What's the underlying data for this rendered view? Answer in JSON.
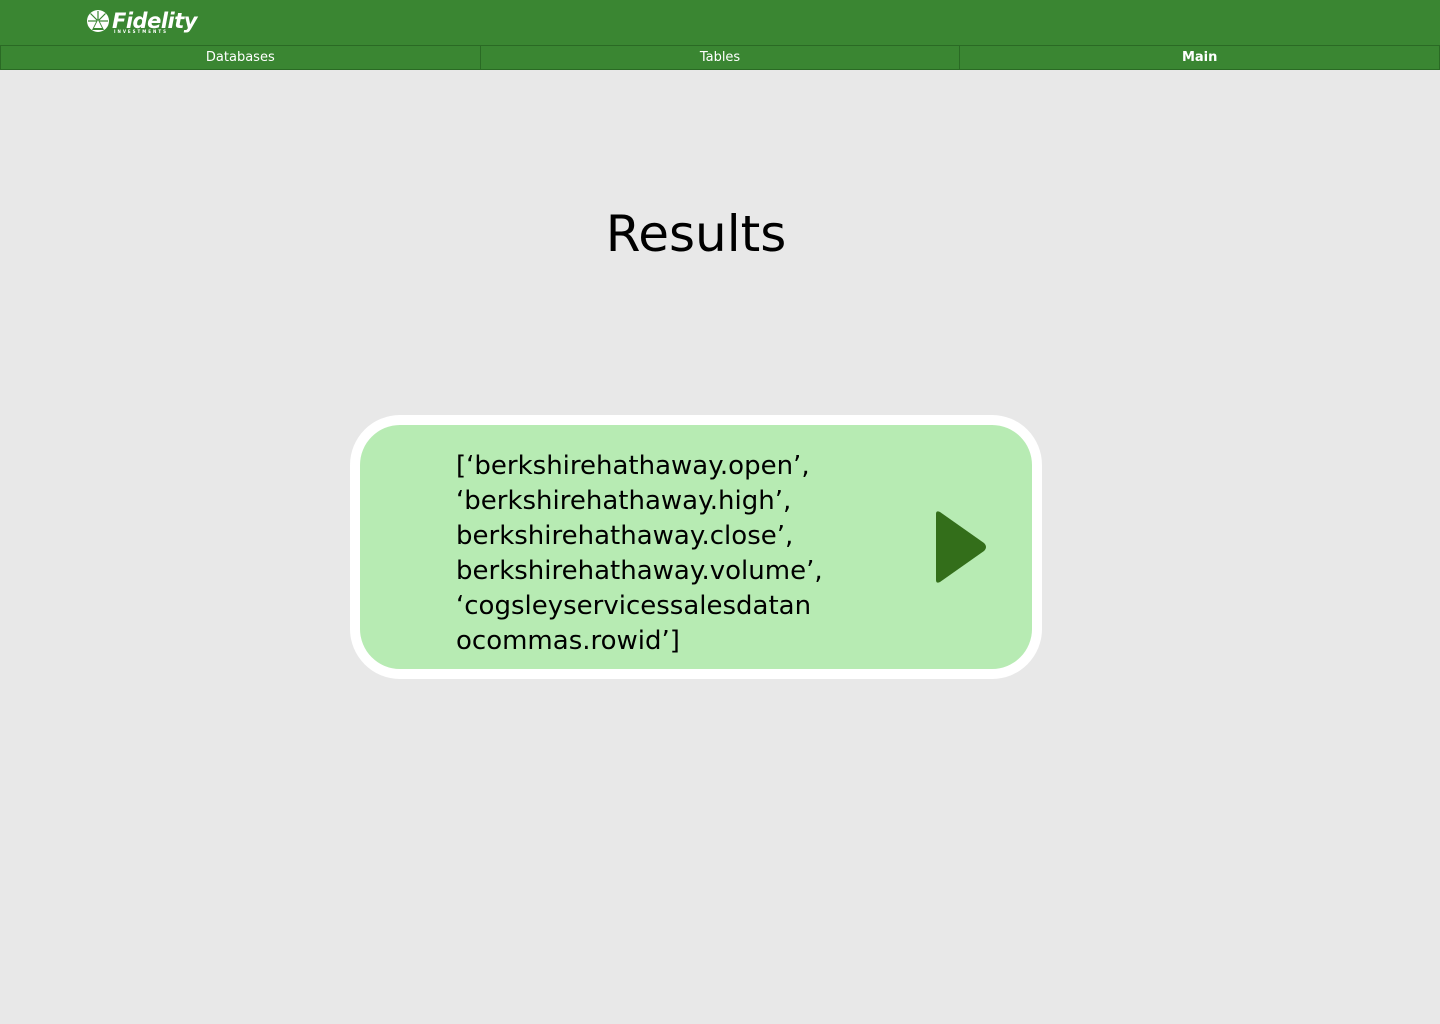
{
  "header": {
    "logo_text": "Fidelity",
    "logo_subtext": "INVESTMENTS",
    "brand_color": "#3a8632"
  },
  "nav": {
    "tabs": [
      {
        "label": "Databases",
        "active": false
      },
      {
        "label": "Tables",
        "active": false
      },
      {
        "label": "Main",
        "active": true
      }
    ]
  },
  "main": {
    "title": "Results",
    "result_text": "[‘berkshirehathaway.open’,\n‘berkshirehathaway.high’,\nberkshirehathaway.close’,\nberkshirehathaway.volume’,\n‘cogsleyservicessalesdatan\nocommas.rowid’]",
    "result_bg": "#b7ebb3",
    "play_icon": "play-icon",
    "play_color": "#336e1a"
  }
}
